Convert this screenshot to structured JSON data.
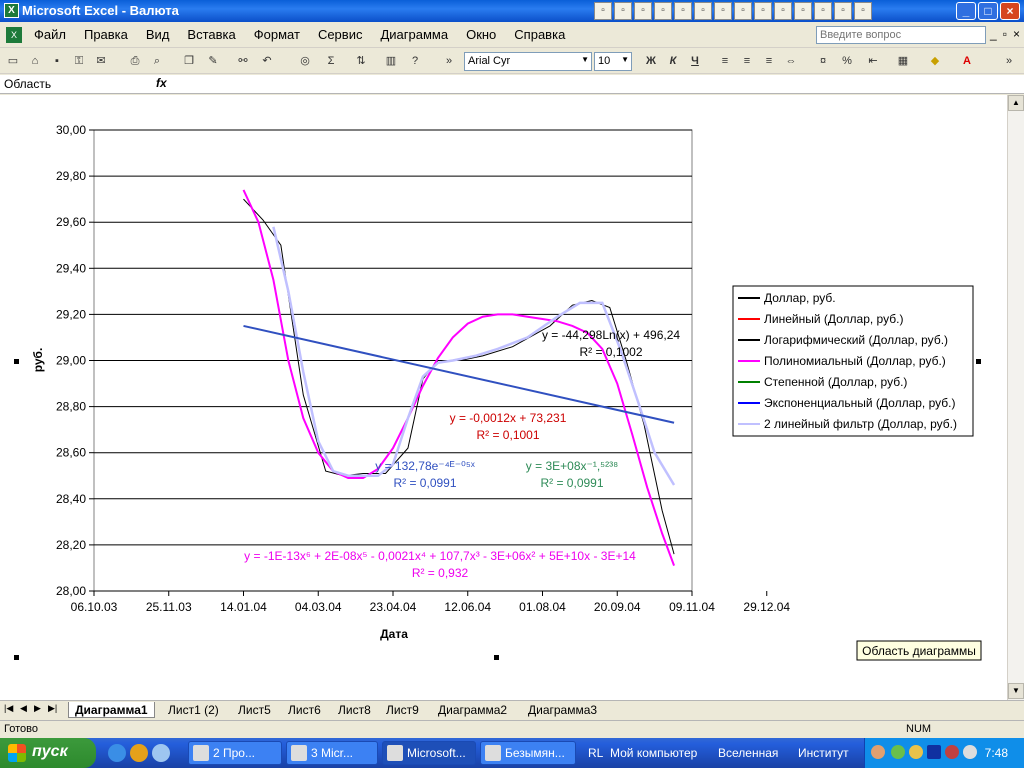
{
  "window": {
    "title": "Microsoft Excel - Валюта"
  },
  "title_icons": [
    "mail-icon",
    "doc-icon",
    "task-icon",
    "note-icon",
    "calendar-icon",
    "pen-icon",
    "word-icon",
    "excel-icon",
    "powerpoint-icon",
    "access-icon",
    "outlook-icon",
    "frontpage-icon",
    "folder-icon",
    "monitor-icon"
  ],
  "menubar": {
    "items": [
      "Файл",
      "Правка",
      "Вид",
      "Вставка",
      "Формат",
      "Сервис",
      "Диаграмма",
      "Окно",
      "Справка"
    ],
    "help_placeholder": "Введите вопрос"
  },
  "toolbar": {
    "font": "Arial Cyr",
    "size": "10",
    "bold": "Ж",
    "italic": "К",
    "underline": "Ч",
    "percent": "%"
  },
  "formula_bar": {
    "name_box": "Область диаграммы",
    "fx": "fx"
  },
  "chart_tooltip": "Область диаграммы",
  "chart_data": {
    "type": "line",
    "xlabel": "Дата",
    "ylabel": "руб.",
    "ylim": [
      28.0,
      30.0
    ],
    "yticks": [
      "28,00",
      "28,20",
      "28,40",
      "28,60",
      "28,80",
      "29,00",
      "29,20",
      "29,40",
      "29,60",
      "29,80",
      "30,00"
    ],
    "xticks": [
      "06.10.03",
      "25.11.03",
      "14.01.04",
      "04.03.04",
      "23.04.04",
      "12.06.04",
      "01.08.04",
      "20.09.04",
      "09.11.04",
      "29.12.04"
    ],
    "legend": [
      {
        "name": "Доллар, руб.",
        "color": "#000000"
      },
      {
        "name": "Линейный (Доллар, руб.)",
        "color": "#ff0000"
      },
      {
        "name": "Логарифмический (Доллар, руб.)",
        "color": "#000000"
      },
      {
        "name": "Полиномиальный (Доллар, руб.)",
        "color": "#ff00ff"
      },
      {
        "name": "Степенной (Доллар, руб.)",
        "color": "#008000"
      },
      {
        "name": "Экспоненциальный (Доллар, руб.)",
        "color": "#0000ff"
      },
      {
        "name": "2 линейный фильтр (Доллар, руб.)",
        "color": "#c0c0ff"
      }
    ],
    "series": [
      {
        "name": "Доллар, руб.",
        "color": "#000000",
        "points": [
          [
            50,
            29.7
          ],
          [
            63,
            29.61
          ],
          [
            75,
            29.5
          ],
          [
            90,
            28.85
          ],
          [
            105,
            28.52
          ],
          [
            117,
            28.5
          ],
          [
            130,
            28.51
          ],
          [
            145,
            28.51
          ],
          [
            160,
            28.62
          ],
          [
            170,
            28.92
          ],
          [
            180,
            29.0
          ],
          [
            195,
            29.0
          ],
          [
            210,
            29.02
          ],
          [
            230,
            29.06
          ],
          [
            255,
            29.15
          ],
          [
            270,
            29.24
          ],
          [
            283,
            29.26
          ],
          [
            295,
            29.23
          ],
          [
            306,
            29.0
          ],
          [
            318,
            28.72
          ],
          [
            330,
            28.35
          ],
          [
            338,
            28.16
          ]
        ]
      },
      {
        "name": "Полиномиальный (Доллар, руб.)",
        "color": "#ff00ff",
        "points": [
          [
            50,
            29.74
          ],
          [
            60,
            29.6
          ],
          [
            70,
            29.35
          ],
          [
            80,
            29.0
          ],
          [
            90,
            28.75
          ],
          [
            100,
            28.6
          ],
          [
            110,
            28.52
          ],
          [
            120,
            28.49
          ],
          [
            130,
            28.49
          ],
          [
            140,
            28.53
          ],
          [
            150,
            28.62
          ],
          [
            160,
            28.75
          ],
          [
            170,
            28.89
          ],
          [
            180,
            29.01
          ],
          [
            190,
            29.1
          ],
          [
            200,
            29.16
          ],
          [
            210,
            29.19
          ],
          [
            220,
            29.2
          ],
          [
            230,
            29.2
          ],
          [
            240,
            29.19
          ],
          [
            250,
            29.18
          ],
          [
            260,
            29.17
          ],
          [
            270,
            29.15
          ],
          [
            280,
            29.12
          ],
          [
            290,
            29.05
          ],
          [
            300,
            28.9
          ],
          [
            310,
            28.68
          ],
          [
            320,
            28.45
          ],
          [
            330,
            28.25
          ],
          [
            338,
            28.11
          ]
        ]
      },
      {
        "name": "2 линейный фильтр (Доллар, руб.)",
        "color": "#c0c0ff",
        "points": [
          [
            70,
            29.58
          ],
          [
            80,
            29.3
          ],
          [
            90,
            28.95
          ],
          [
            100,
            28.65
          ],
          [
            110,
            28.52
          ],
          [
            120,
            28.5
          ],
          [
            130,
            28.5
          ],
          [
            140,
            28.5
          ],
          [
            150,
            28.55
          ],
          [
            160,
            28.75
          ],
          [
            170,
            28.93
          ],
          [
            180,
            28.99
          ],
          [
            190,
            29.0
          ],
          [
            205,
            29.02
          ],
          [
            220,
            29.05
          ],
          [
            240,
            29.1
          ],
          [
            260,
            29.19
          ],
          [
            275,
            29.25
          ],
          [
            290,
            29.25
          ],
          [
            302,
            29.05
          ],
          [
            315,
            28.8
          ],
          [
            325,
            28.6
          ],
          [
            338,
            28.46
          ]
        ]
      },
      {
        "name": "Экспоненциальный (Доллар, руб.)",
        "color": "#3050c0",
        "points": [
          [
            50,
            29.15
          ],
          [
            338,
            28.73
          ]
        ]
      }
    ],
    "annotations": [
      {
        "lines": [
          "y = -44,298Ln(x) + 496,24",
          "R² = 0,1002"
        ],
        "color": "#000000"
      },
      {
        "lines": [
          "y = -0,0012x + 73,231",
          "R² = 0,1001"
        ],
        "color": "#cc0000"
      },
      {
        "lines": [
          "y = 132,78e⁻⁴ᴱ⁻⁰⁵ˣ",
          "R² = 0,0991"
        ],
        "color": "#3050c0"
      },
      {
        "lines": [
          "y = 3E+08x⁻¹,⁵²³⁸",
          "R² = 0,0991"
        ],
        "color": "#2e8b57"
      },
      {
        "lines": [
          "y = -1E-13x⁶ + 2E-08x⁵ - 0,0021x⁴ + 107,7x³ - 3E+06x² + 5E+10x - 3E+14",
          "R² = 0,932"
        ],
        "color": "#ee00ee"
      }
    ]
  },
  "sheet_tabs": [
    "Диаграмма1",
    "Лист1 (2)",
    "Лист5",
    "Лист6",
    "Лист8",
    "Лист9",
    "Диаграмма2",
    "Диаграмма3"
  ],
  "status": {
    "left": "Готово",
    "mode": "NUM"
  },
  "taskbar": {
    "start": "пуск",
    "tasks": [
      "2 Про...",
      "3 Micr...",
      "Microsoft...",
      "Безымян..."
    ],
    "links": [
      "RL",
      "Мой компьютер",
      "Вселенная",
      "Институт"
    ],
    "clock": "7:48"
  }
}
